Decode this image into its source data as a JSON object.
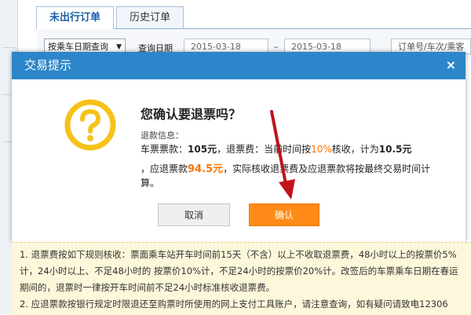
{
  "tabs": [
    {
      "label": "未出行订单"
    },
    {
      "label": "历史订单"
    }
  ],
  "search": {
    "mode_select": "按乘车日期查询",
    "date_label": "查询日期",
    "date_from": "2015-03-18",
    "separator": "–",
    "date_to": "2015-03-18",
    "keyword_placeholder": "订单号/车次/乘客"
  },
  "modal": {
    "title": "交易提示",
    "close": "×",
    "heading": "您确认要退票吗？",
    "refund_info_label": "退款信息：",
    "fare_label": "车票票款：",
    "fare_value": "105元",
    "fee_label": "，退票费：",
    "fee_desc_pre": "当前时间按",
    "fee_rate": "10%",
    "fee_desc_post": "核收，计为",
    "fee_value": "10.5元",
    "refund_pre": "，应退票款",
    "refund_value": "94.5元",
    "refund_post": "，实际核收退票费及应退票款将按最终交易时间计",
    "refund_tail": "算。",
    "cancel_button": "取消",
    "ok_button": "确认"
  },
  "notice": {
    "p1_line1": "1. 退票费按如下规则核收：票面乘车站开车时间前15天（不含）以上不收取退票费，48小时以上的按票价5%",
    "p1_line2": "计，24小时以上、不足48小时的 按票价10%计，不足24小时的按票价20%计。改签后的车票乘车日期在春运",
    "p1_line3": "期间的，退票时一律按开车时间前不足24小时标准核收退票费。",
    "p2_line1": "2. 应退票款按银行规定时限退还至购票时所使用的网上支付工具账户，请注意查询，如有疑问请致电12306"
  },
  "colors": {
    "header_blue": "#2d86c9",
    "accent_orange": "#ff7200",
    "ok_button": "#ff8a17",
    "arrow_red": "#c0141a",
    "icon_yellow": "#f6c21a",
    "notice_bg": "#fdf8db"
  }
}
